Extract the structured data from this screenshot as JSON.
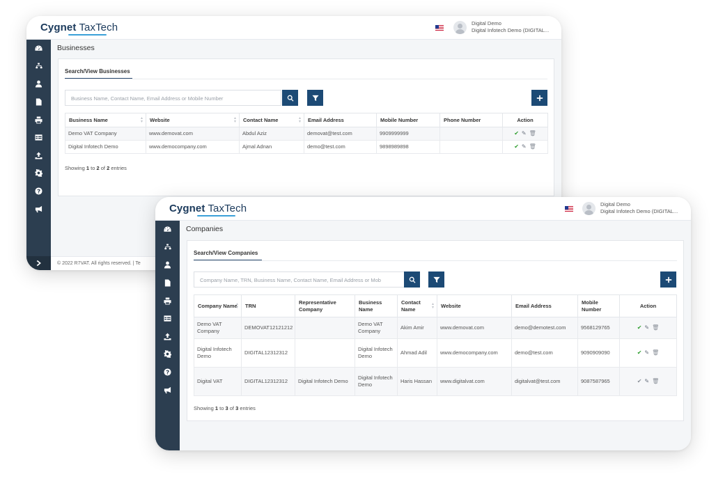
{
  "back_window": {
    "app": {
      "logo_part1": "Cygnet",
      "logo_part2": "TaxTech"
    },
    "user": {
      "name": "Digital Demo",
      "org": "Digital Infotech Demo (DIGITAL..."
    },
    "page_title": "Businesses",
    "tab_label": "Search/View Businesses",
    "search_placeholder": "Business Name, Contact Name, Email Address or Mobile Number",
    "columns": [
      "Business Name",
      "Website",
      "Contact Name",
      "Email Address",
      "Mobile Number",
      "Phone Number",
      "Action"
    ],
    "rows": [
      {
        "business_name": "Demo VAT Company",
        "website": "www.demovat.com",
        "contact_name": "Abdul Aziz",
        "email": "demovat@test.com",
        "mobile": "9909999999",
        "phone": ""
      },
      {
        "business_name": "Digital Infotech Demo",
        "website": "www.democompany.com",
        "contact_name": "Ajmal Adnan",
        "email": "demo@test.com",
        "mobile": "9898989898",
        "phone": ""
      }
    ],
    "showing": {
      "prefix": "Showing",
      "from": "1",
      "to_word": "to",
      "to": "2",
      "of_word": "of",
      "total": "2",
      "suffix": "entries"
    },
    "footer": "© 2022 R7VAT. All rights reserved.  |  Te"
  },
  "front_window": {
    "app": {
      "logo_part1": "Cygnet",
      "logo_part2": "TaxTech"
    },
    "user": {
      "name": "Digital Demo",
      "org": "Digital Infotech Demo (DIGITAL..."
    },
    "page_title": "Companies",
    "tab_label": "Search/View Companies",
    "search_placeholder": "Company Name, TRN, Business Name, Contact Name, Email Address or Mob",
    "columns": [
      "Company Name",
      "TRN",
      "Representative Company",
      "Business Name",
      "Contact Name",
      "Website",
      "Email Address",
      "Mobile Number",
      "Action"
    ],
    "rows": [
      {
        "company_name": "Demo VAT Company",
        "trn": "DEMOVAT12121212",
        "representative": "",
        "business_name": "Demo VAT Company",
        "contact_name": "Akim Amir",
        "website": "www.demovat.com",
        "email": "demo@demotest.com",
        "mobile": "9568129765"
      },
      {
        "company_name": "Digital Infotech Demo",
        "trn": "DIGITAL12312312",
        "representative": "",
        "business_name": "Digital Infotech Demo",
        "contact_name": "Ahmad Adil",
        "website": "www.democompany.com",
        "email": "demo@test.com",
        "mobile": "9090909090"
      },
      {
        "company_name": "Digital VAT",
        "trn": "DIGITAL12312312",
        "representative": "Digital Infotech Demo",
        "business_name": "Digital Infotech Demo",
        "contact_name": "Haris Hassan",
        "website": "www.digitalvat.com",
        "email": "digitalvat@test.com",
        "mobile": "9087587965"
      }
    ],
    "showing": {
      "prefix": "Showing",
      "from": "1",
      "to_word": "to",
      "to": "3",
      "of_word": "of",
      "total": "3",
      "suffix": "entries"
    }
  },
  "sidebar_icons": [
    "dashboard-icon",
    "sitemap-icon",
    "user-icon",
    "document-icon",
    "print-icon",
    "table-icon",
    "upload-icon",
    "settings-icon",
    "help-icon",
    "announcement-icon"
  ],
  "colors": {
    "sidebar": "#2c3e50",
    "primary_button": "#1c4a75",
    "logo": "#1b3a5c",
    "logo_underline": "#3aa0d8",
    "approve": "#2e9e2e"
  }
}
